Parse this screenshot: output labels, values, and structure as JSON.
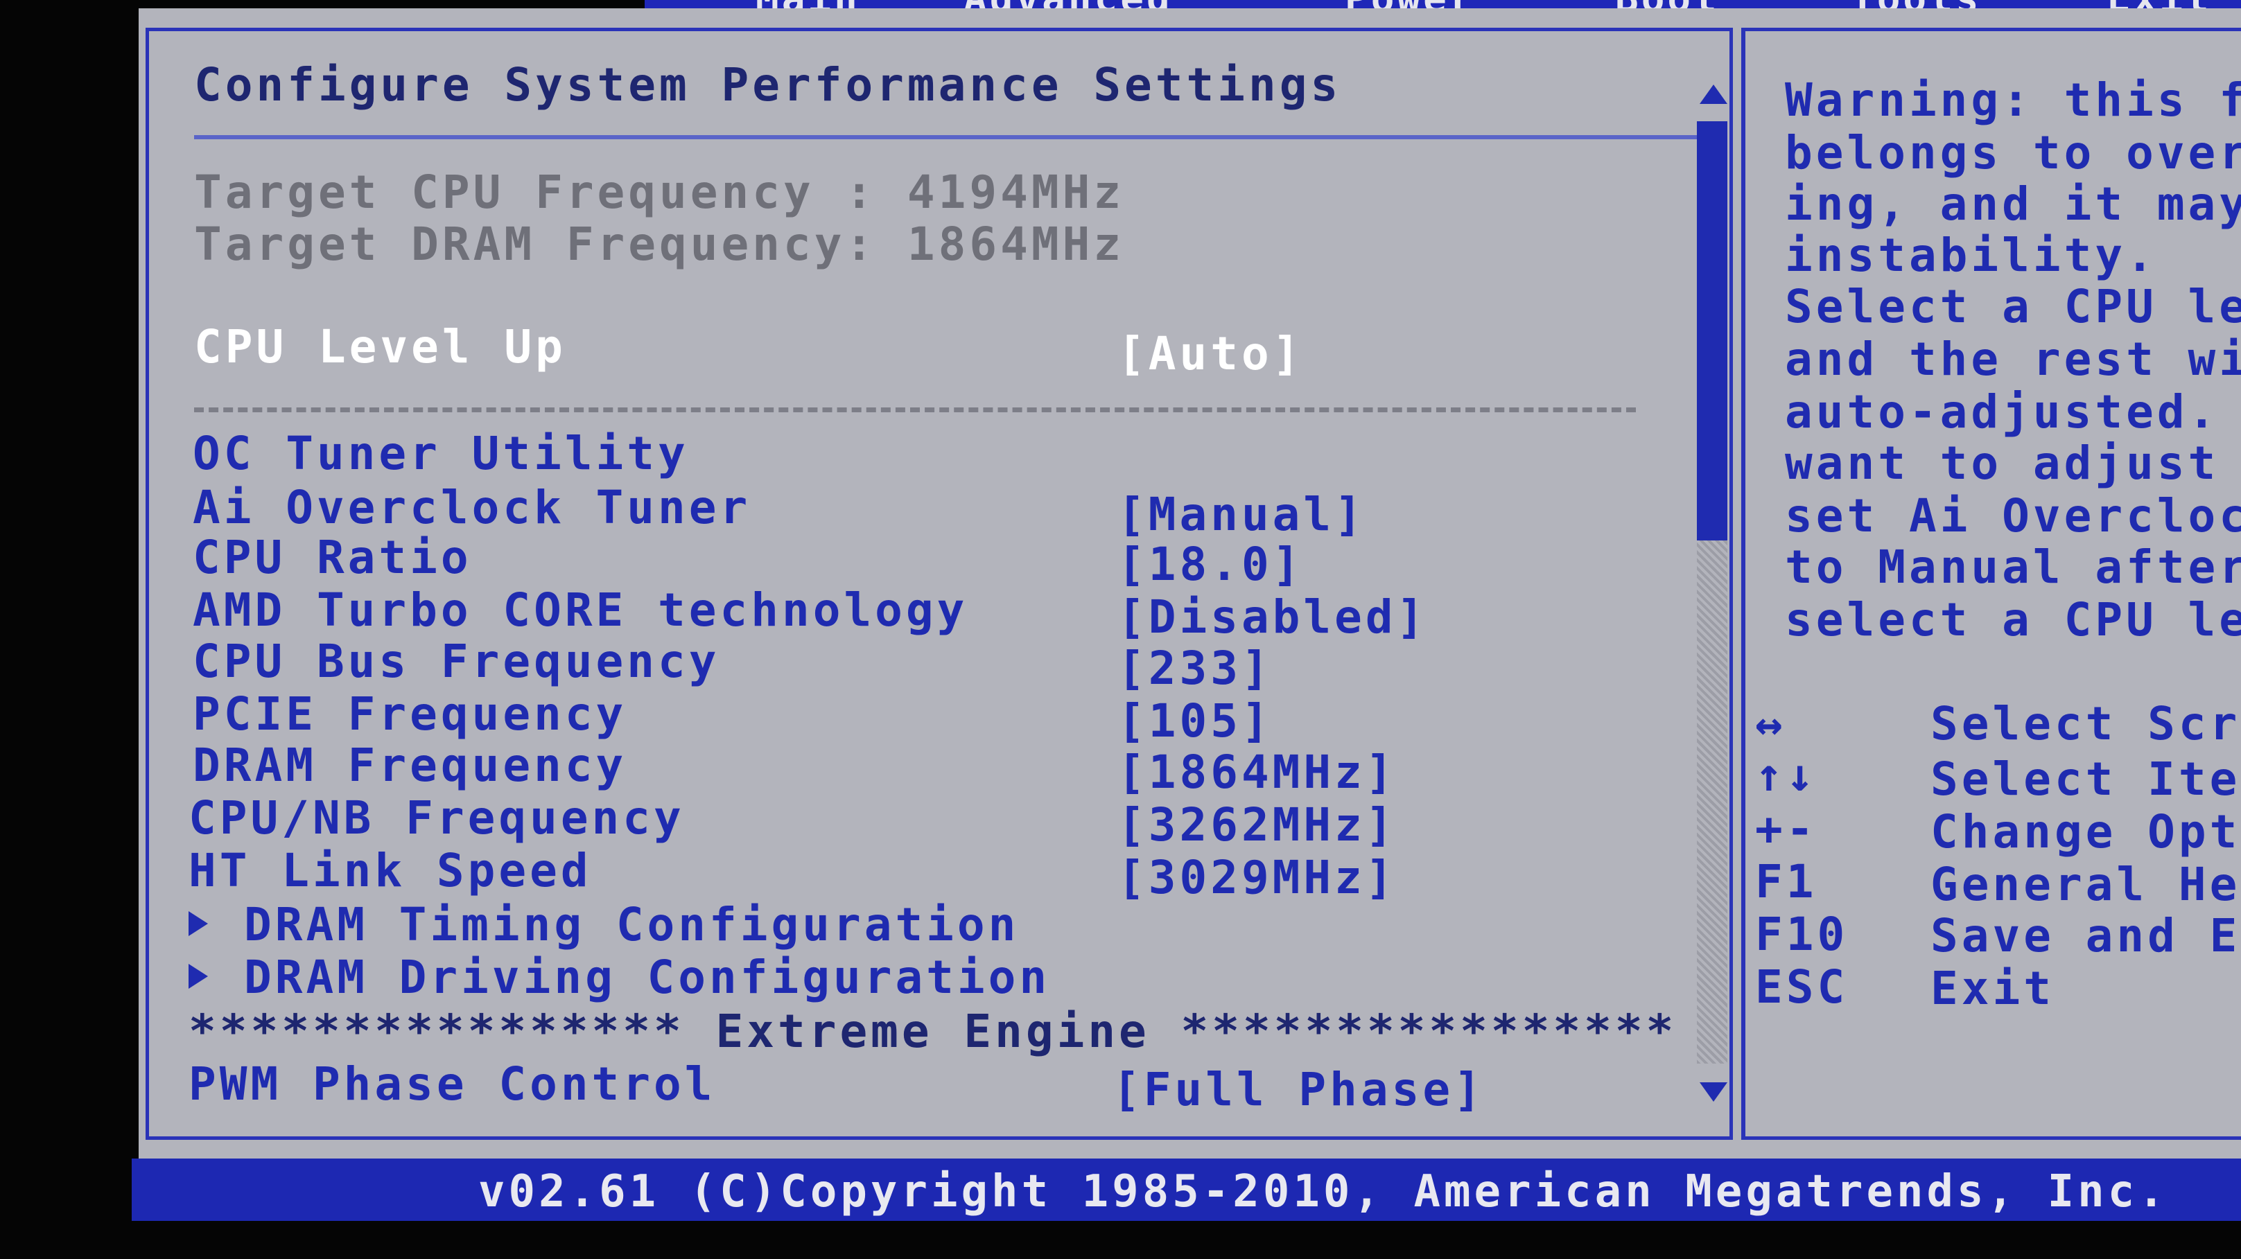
{
  "menu": {
    "tabs": [
      "Main",
      "Advanced",
      "Power",
      "Boot",
      "Tools",
      "Exit"
    ]
  },
  "page": {
    "title": "Configure System Performance Settings"
  },
  "info": {
    "cpu_frequency": "Target CPU Frequency : 4194MHz",
    "dram_frequency": "Target DRAM Frequency: 1864MHz"
  },
  "settings": {
    "cpu_level_up": {
      "label": "CPU Level Up",
      "value": "[Auto]"
    },
    "oc_tuner_utility": {
      "label": "OC Tuner Utility"
    },
    "ai_overclock_tuner": {
      "label": "Ai Overclock Tuner",
      "value": "[Manual]"
    },
    "cpu_ratio": {
      "label": "CPU Ratio",
      "value": "[18.0]"
    },
    "amd_turbo_core": {
      "label": "AMD Turbo CORE technology",
      "value": "[Disabled]"
    },
    "cpu_bus_frequency": {
      "label": "CPU Bus Frequency",
      "value": "[233]"
    },
    "pcie_frequency": {
      "label": "PCIE Frequency",
      "value": "[105]"
    },
    "dram_frequency": {
      "label": "DRAM Frequency",
      "value": "[1864MHz]"
    },
    "cpu_nb_frequency": {
      "label": "CPU/NB Frequency",
      "value": "[3262MHz]"
    },
    "ht_link_speed": {
      "label": "HT Link Speed",
      "value": "[3029MHz]"
    },
    "dram_timing": {
      "label": "DRAM Timing Configuration"
    },
    "dram_driving": {
      "label": "DRAM Driving Configuration"
    },
    "extreme_engine": {
      "label": "**************** Extreme Engine ****************"
    },
    "pwm_phase_control": {
      "label": "PWM Phase Control",
      "value": "[Full Phase]"
    }
  },
  "help": {
    "lines": [
      "Warning: this fu",
      "belongs to overc",
      "ing, and it may",
      "instability.",
      "Select a CPU lev",
      "and the rest wil",
      "auto-adjusted. I",
      "want to adjust m",
      "set Ai Overclock",
      "to Manual after",
      "select a CPU lev"
    ],
    "keys": [
      {
        "key": "↔",
        "desc": "Select Scre"
      },
      {
        "key": "↑↓",
        "desc": "Select Item"
      },
      {
        "key": "+-",
        "desc": "Change Opti"
      },
      {
        "key": "F1",
        "desc": "General Hel"
      },
      {
        "key": "F10",
        "desc": "Save and Ex"
      },
      {
        "key": "ESC",
        "desc": "Exit"
      }
    ]
  },
  "footer": {
    "copyright": "v02.61 (C)Copyright 1985-2010, American Megatrends, Inc."
  },
  "colors": {
    "background": "#b3b4bc",
    "accent_blue": "#1f2bb0",
    "selected_text": "#ffffff",
    "disabled_text": "#6f7079"
  }
}
